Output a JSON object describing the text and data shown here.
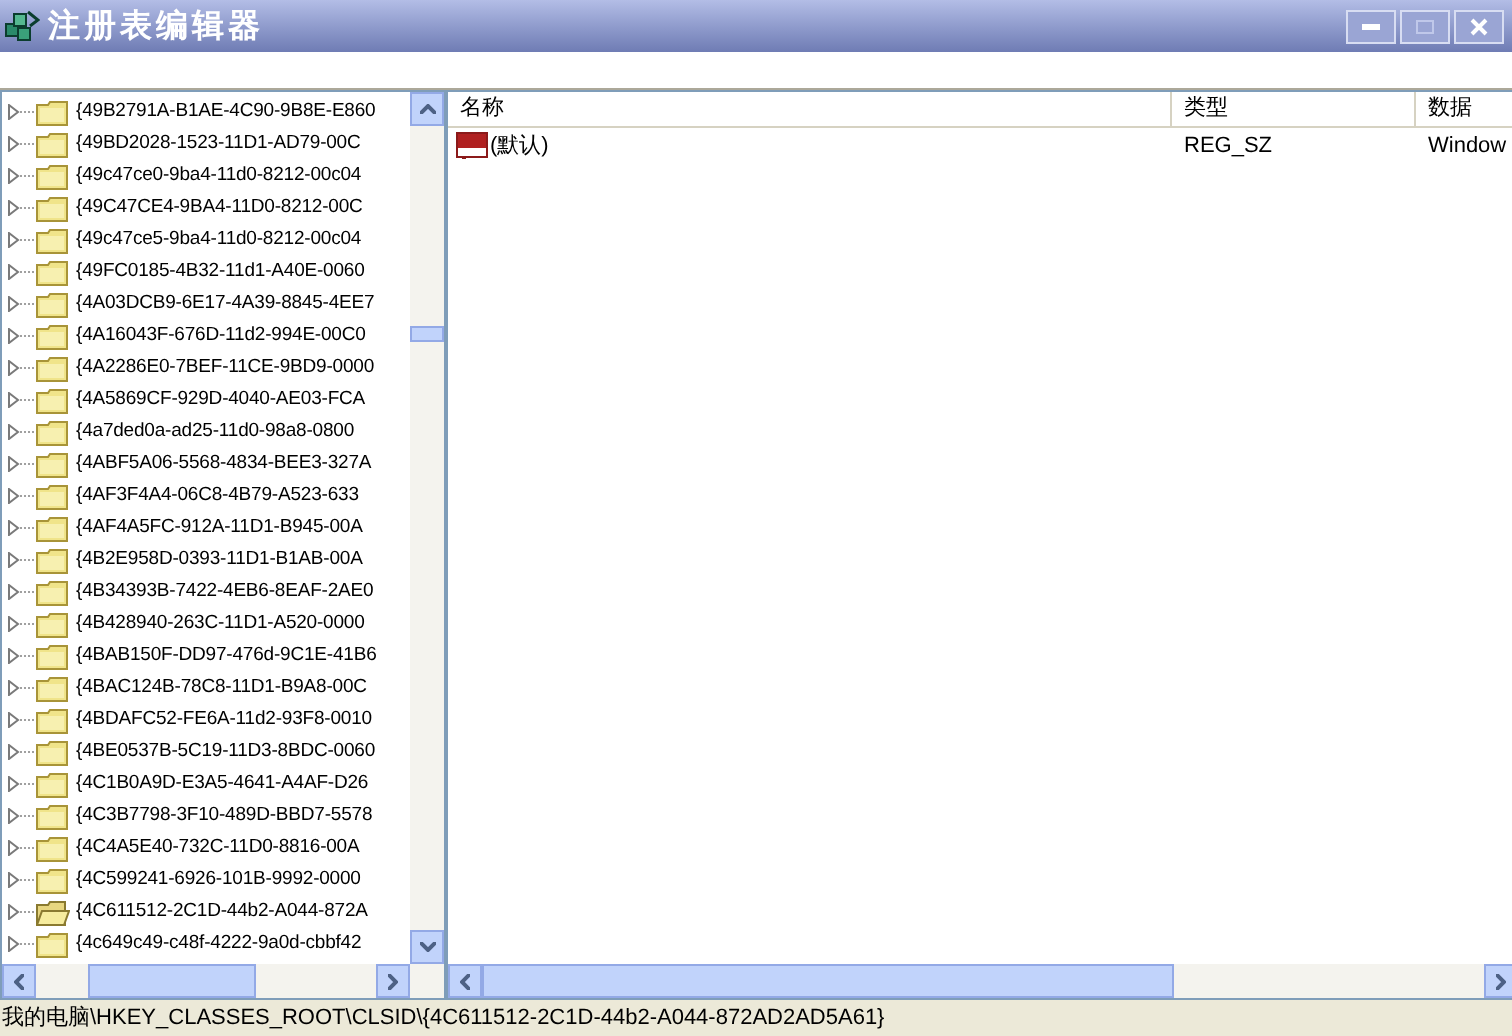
{
  "window": {
    "title": "注册表编辑器"
  },
  "tree": {
    "items": [
      {
        "label": "{49B2791A-B1AE-4C90-9B8E-E860",
        "selected": false
      },
      {
        "label": "{49BD2028-1523-11D1-AD79-00C",
        "selected": false
      },
      {
        "label": "{49c47ce0-9ba4-11d0-8212-00c04",
        "selected": false
      },
      {
        "label": "{49C47CE4-9BA4-11D0-8212-00C",
        "selected": false
      },
      {
        "label": "{49c47ce5-9ba4-11d0-8212-00c04",
        "selected": false
      },
      {
        "label": "{49FC0185-4B32-11d1-A40E-0060",
        "selected": false
      },
      {
        "label": "{4A03DCB9-6E17-4A39-8845-4EE7",
        "selected": false
      },
      {
        "label": "{4A16043F-676D-11d2-994E-00C0",
        "selected": false
      },
      {
        "label": "{4A2286E0-7BEF-11CE-9BD9-0000",
        "selected": false
      },
      {
        "label": "{4A5869CF-929D-4040-AE03-FCA",
        "selected": false
      },
      {
        "label": "{4a7ded0a-ad25-11d0-98a8-0800",
        "selected": false
      },
      {
        "label": "{4ABF5A06-5568-4834-BEE3-327A",
        "selected": false
      },
      {
        "label": "{4AF3F4A4-06C8-4B79-A523-633",
        "selected": false
      },
      {
        "label": "{4AF4A5FC-912A-11D1-B945-00A",
        "selected": false
      },
      {
        "label": "{4B2E958D-0393-11D1-B1AB-00A",
        "selected": false
      },
      {
        "label": "{4B34393B-7422-4EB6-8EAF-2AE0",
        "selected": false
      },
      {
        "label": "{4B428940-263C-11D1-A520-0000",
        "selected": false
      },
      {
        "label": "{4BAB150F-DD97-476d-9C1E-41B6",
        "selected": false
      },
      {
        "label": "{4BAC124B-78C8-11D1-B9A8-00C",
        "selected": false
      },
      {
        "label": "{4BDAFC52-FE6A-11d2-93F8-0010",
        "selected": false
      },
      {
        "label": "{4BE0537B-5C19-11D3-8BDC-0060",
        "selected": false
      },
      {
        "label": "{4C1B0A9D-E3A5-4641-A4AF-D26",
        "selected": false
      },
      {
        "label": "{4C3B7798-3F10-489D-BBD7-5578",
        "selected": false
      },
      {
        "label": "{4C4A5E40-732C-11D0-8816-00A",
        "selected": false
      },
      {
        "label": "{4C599241-6926-101B-9992-0000",
        "selected": false
      },
      {
        "label": "{4C611512-2C1D-44b2-A044-872A",
        "selected": true
      },
      {
        "label": "{4c649c49-c48f-4222-9a0d-cbbf42",
        "selected": false
      }
    ]
  },
  "table": {
    "columns": [
      "名称",
      "类型",
      "数据"
    ],
    "rows": [
      {
        "name": "(默认)",
        "type": "REG_SZ",
        "data": "Window"
      }
    ]
  },
  "status_bar": "我的电脑\\HKEY_CLASSES_ROOT\\CLSID\\{4C611512-2C1D-44b2-A044-872AD2AD5A61}"
}
